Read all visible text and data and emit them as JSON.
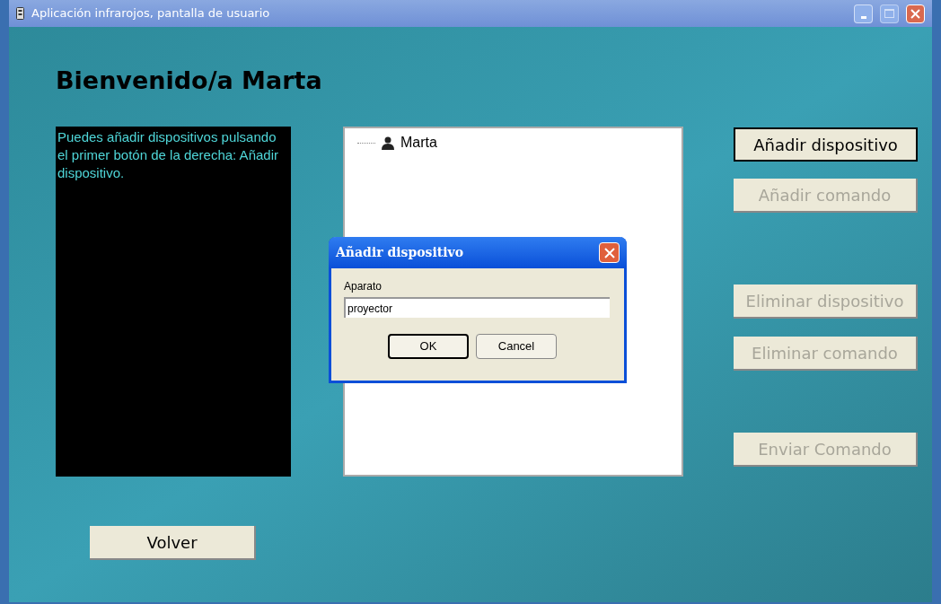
{
  "window": {
    "title": "Aplicación infrarojos, pantalla de usuario"
  },
  "heading": "Bienvenido/a Marta",
  "help_text": "Puedes añadir dispositivos pulsando el primer botón de la derecha: Añadir dispositivo.",
  "tree": {
    "items": [
      {
        "label": "Marta"
      }
    ]
  },
  "buttons": [
    {
      "label": "Añadir dispositivo",
      "disabled": false
    },
    {
      "label": "Añadir comando",
      "disabled": true
    },
    {
      "label": "Eliminar dispositivo",
      "disabled": true
    },
    {
      "label": "Eliminar comando",
      "disabled": true
    },
    {
      "label": "Enviar Comando",
      "disabled": true
    }
  ],
  "back_button": "Volver",
  "dialog": {
    "title": "Añadir dispositivo",
    "field_label": "Aparato",
    "value": "proyector",
    "buttons": [
      "OK",
      "Cancel"
    ]
  }
}
